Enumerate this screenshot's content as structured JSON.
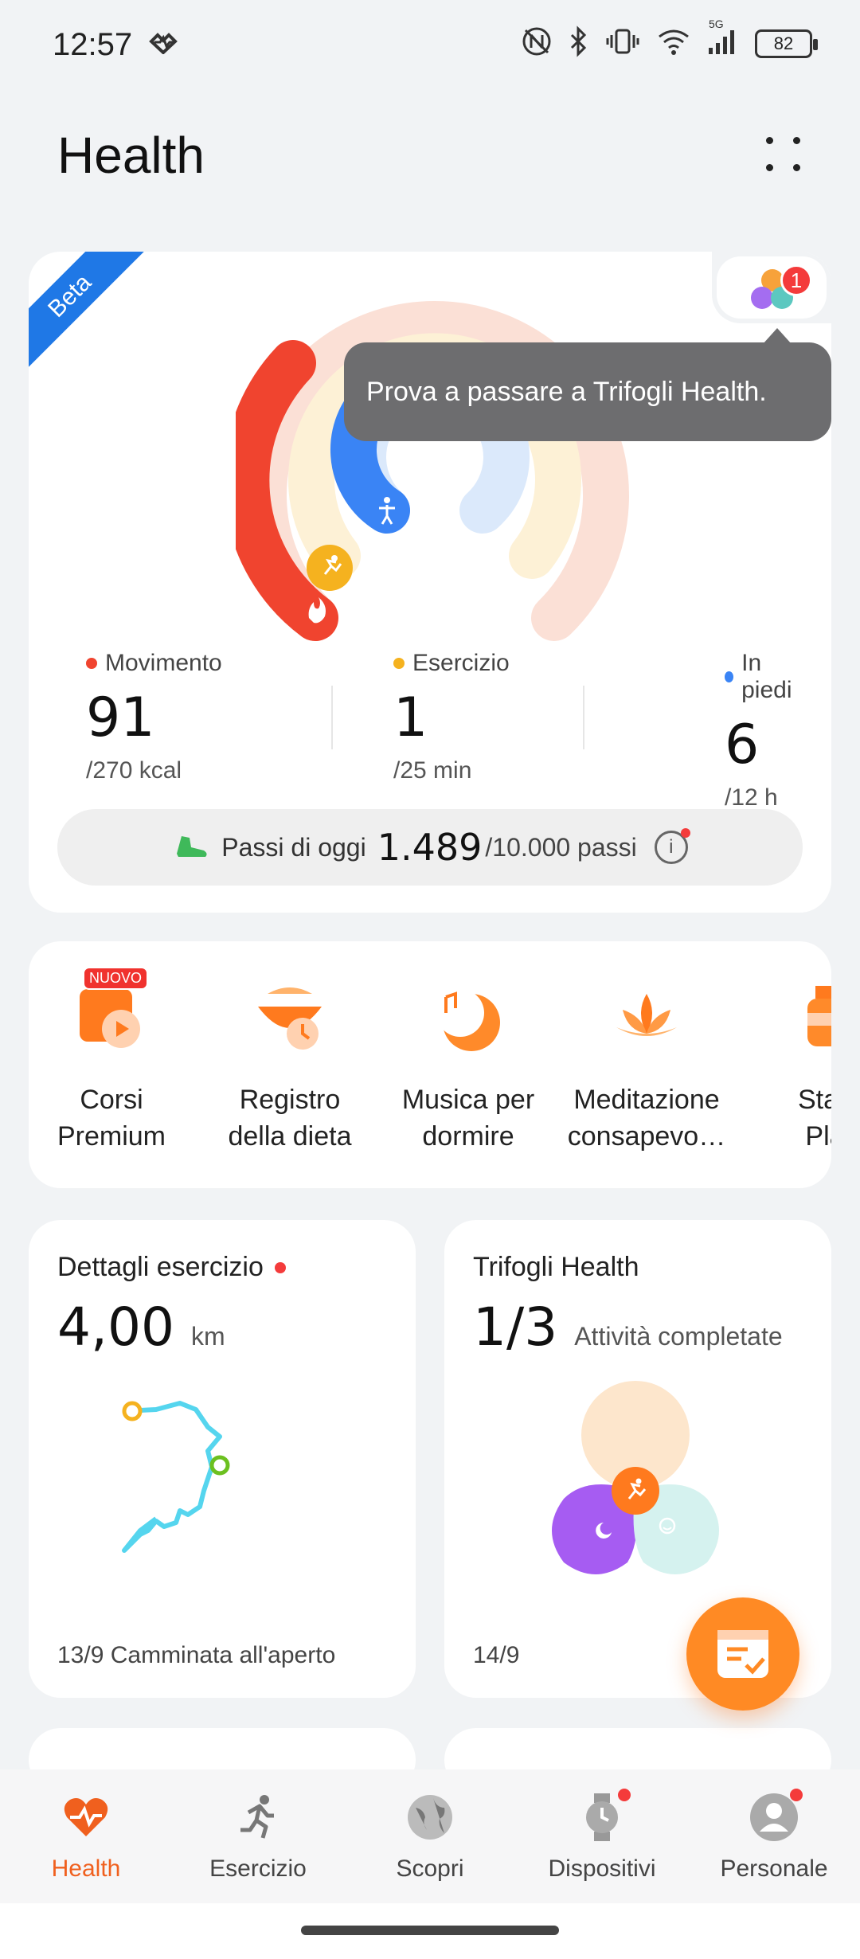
{
  "status_bar": {
    "time": "12:57",
    "battery": "82",
    "network": "5G"
  },
  "header": {
    "title": "Health"
  },
  "activity_card": {
    "beta_label": "Beta",
    "trifogli_badge_count": "1",
    "tooltip": "Prova a passare a Trifogli Health.",
    "stats": [
      {
        "label": "Movimento",
        "value": "91",
        "goal": "/270 kcal",
        "color": "#f0442f"
      },
      {
        "label": "Esercizio",
        "value": "1",
        "goal": "/25 min",
        "color": "#f5b21f"
      },
      {
        "label": "In piedi",
        "value": "6",
        "goal": "/12 h",
        "color": "#3a84f5"
      }
    ],
    "steps": {
      "label": "Passi di oggi",
      "value": "1.489",
      "goal": "/10.000 passi"
    }
  },
  "shortcuts": [
    {
      "label_line1": "Corsi",
      "label_line2": "Premium",
      "badge": "NUOVO"
    },
    {
      "label_line1": "Registro",
      "label_line2": "della dieta"
    },
    {
      "label_line1": "Musica per",
      "label_line2": "dormire"
    },
    {
      "label_line1": "Meditazione",
      "label_line2": "consapevo…"
    },
    {
      "label_line1": "Stay",
      "label_line2": "Pla"
    }
  ],
  "exercise_card": {
    "title": "Dettagli esercizio",
    "distance": "4,00",
    "unit": "km",
    "footer": "13/9  Camminata all'aperto"
  },
  "trifogli_card": {
    "title": "Trifogli Health",
    "progress": "1/3",
    "progress_label": "Attività completate",
    "footer": "14/9"
  },
  "bottom_nav": [
    {
      "label": "Health",
      "active": true
    },
    {
      "label": "Esercizio"
    },
    {
      "label": "Scopri"
    },
    {
      "label": "Dispositivi"
    },
    {
      "label": "Personale"
    }
  ],
  "colors": {
    "accent": "#f0601e",
    "movement": "#f0442f",
    "exercise": "#f5b21f",
    "stand": "#3a84f5"
  }
}
